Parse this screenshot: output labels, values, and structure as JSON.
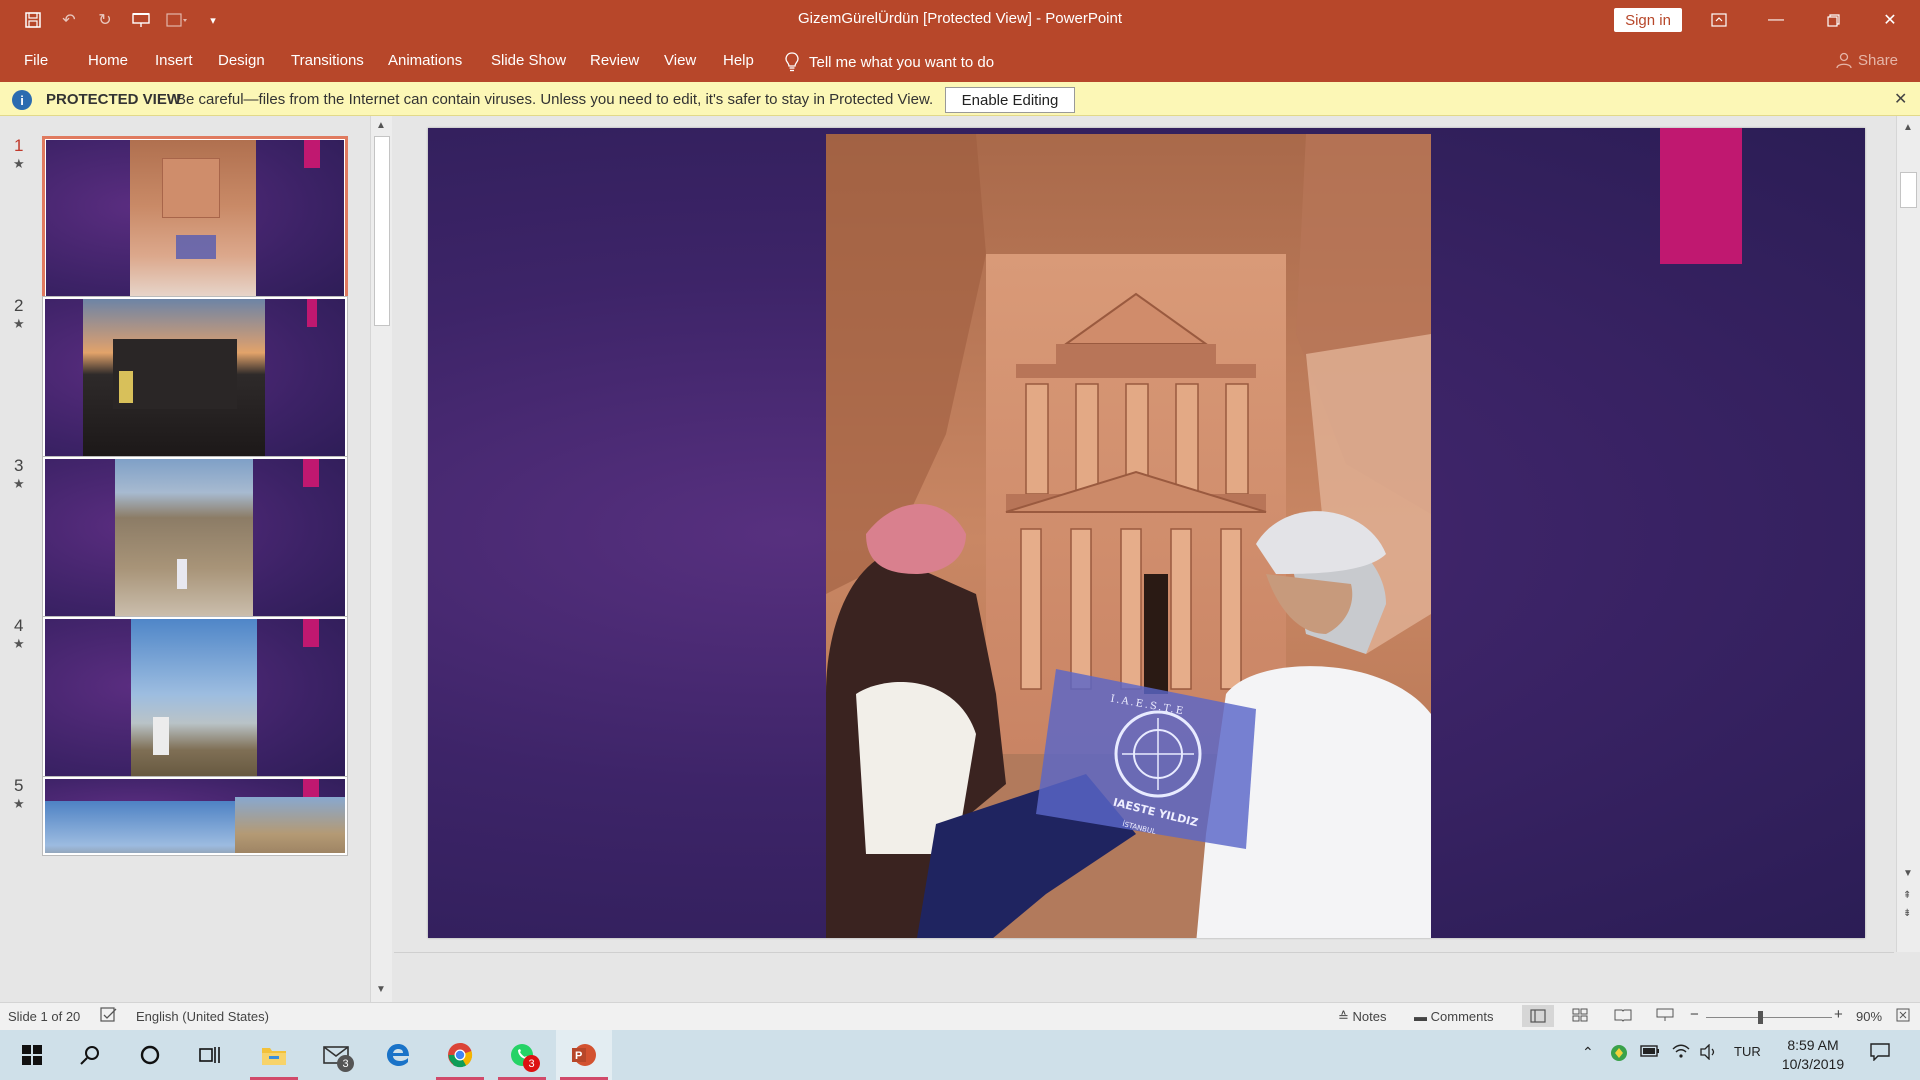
{
  "window": {
    "title": "GizemGürelÜrdün  [Protected View]  -  PowerPoint",
    "sign_in": "Sign in"
  },
  "ribbon": {
    "tabs": [
      "File",
      "Home",
      "Insert",
      "Design",
      "Transitions",
      "Animations",
      "Slide Show",
      "Review",
      "View",
      "Help"
    ],
    "tell_me": "Tell me what you want to do",
    "share": "Share"
  },
  "banner": {
    "label": "PROTECTED VIEW",
    "message": "Be careful—files from the Internet can contain viruses. Unless you need to edit, it's safer to stay in Protected View.",
    "enable_button": "Enable Editing"
  },
  "thumbnails": [
    {
      "number": "1",
      "star": "★",
      "selected": true
    },
    {
      "number": "2",
      "star": "★",
      "selected": false
    },
    {
      "number": "3",
      "star": "★",
      "selected": false
    },
    {
      "number": "4",
      "star": "★",
      "selected": false
    },
    {
      "number": "5",
      "star": "★",
      "selected": false
    }
  ],
  "slide_image": {
    "flag_text_top": "I.A.E.S.T.E",
    "flag_text_main": "IAESTE YILDIZ",
    "flag_text_city": "İSTANBUL"
  },
  "statusbar": {
    "slide_info": "Slide 1 of 20",
    "language": "English (United States)",
    "notes": "Notes",
    "comments": "Comments",
    "zoom": "90%",
    "zoom_level": 0.9
  },
  "taskbar": {
    "mail_badge": "3",
    "whatsapp_badge": "3",
    "language": "TUR",
    "time": "8:59 AM",
    "date": "10/3/2019"
  },
  "colors": {
    "accent": "#b7472a",
    "banner": "#fcf7b6",
    "slide_bg": "#3d2468",
    "slide_tag": "#c01870"
  }
}
